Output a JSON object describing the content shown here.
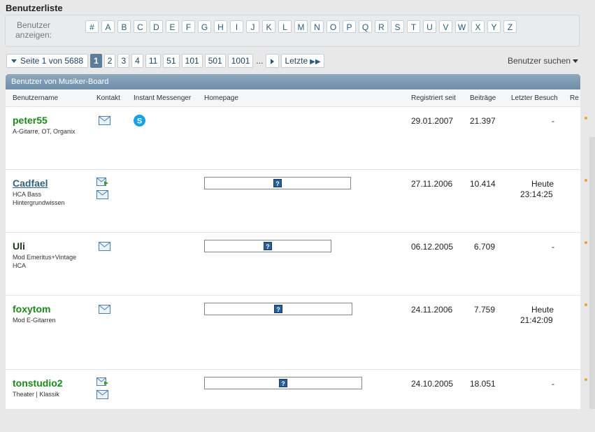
{
  "page": {
    "title": "Benutzerliste"
  },
  "letters": {
    "label": "Benutzer anzeigen:",
    "items": [
      "#",
      "A",
      "B",
      "C",
      "D",
      "E",
      "F",
      "G",
      "H",
      "I",
      "J",
      "K",
      "L",
      "M",
      "N",
      "O",
      "P",
      "Q",
      "R",
      "S",
      "T",
      "U",
      "V",
      "W",
      "X",
      "Y",
      "Z"
    ]
  },
  "pagination": {
    "info": "Seite 1 von 5688",
    "pages": [
      "1",
      "2",
      "3",
      "4",
      "11",
      "51",
      "101",
      "501",
      "1001"
    ],
    "ellipsis": "...",
    "last": "Letzte",
    "search": "Benutzer suchen"
  },
  "table": {
    "panel_title": "Benutzer von Musiker-Board",
    "columns": [
      "Benutzername",
      "Kontakt",
      "Instant Messenger",
      "Homepage",
      "Registriert seit",
      "Beiträge",
      "Letzter Besuch",
      "Re"
    ],
    "rows": [
      {
        "name": "peter55",
        "title": "A-Gitarre, OT, Organix",
        "registered": "29.01.2007",
        "posts": "21.397",
        "last_visit": "-",
        "last_time": ""
      },
      {
        "name": "Cadfael",
        "title": "HCA Bass Hintergrundwissen",
        "registered": "27.11.2006",
        "posts": "10.414",
        "last_visit": "Heute",
        "last_time": "23:14:25"
      },
      {
        "name": "Uli",
        "title": "Mod Emeritus+Vintage HCA",
        "registered": "06.12.2005",
        "posts": "6.709",
        "last_visit": "-",
        "last_time": ""
      },
      {
        "name": "foxytom",
        "title": "Mod E-Gitarren",
        "registered": "24.11.2006",
        "posts": "7.759",
        "last_visit": "Heute",
        "last_time": "21:42:09"
      },
      {
        "name": "tonstudio2",
        "title": "Theater | Klassik",
        "registered": "24.10.2005",
        "posts": "18.051",
        "last_visit": "-",
        "last_time": ""
      }
    ]
  },
  "icons": {
    "email": "envelope-icon",
    "send": "send-message-icon",
    "skype": "skype-icon",
    "question": "question-mark-icon"
  },
  "colors": {
    "username_green": "#1a8a1a",
    "username_blue": "#34607f",
    "header_bar": "#7a98b2",
    "active_page": "#5a7d99"
  }
}
